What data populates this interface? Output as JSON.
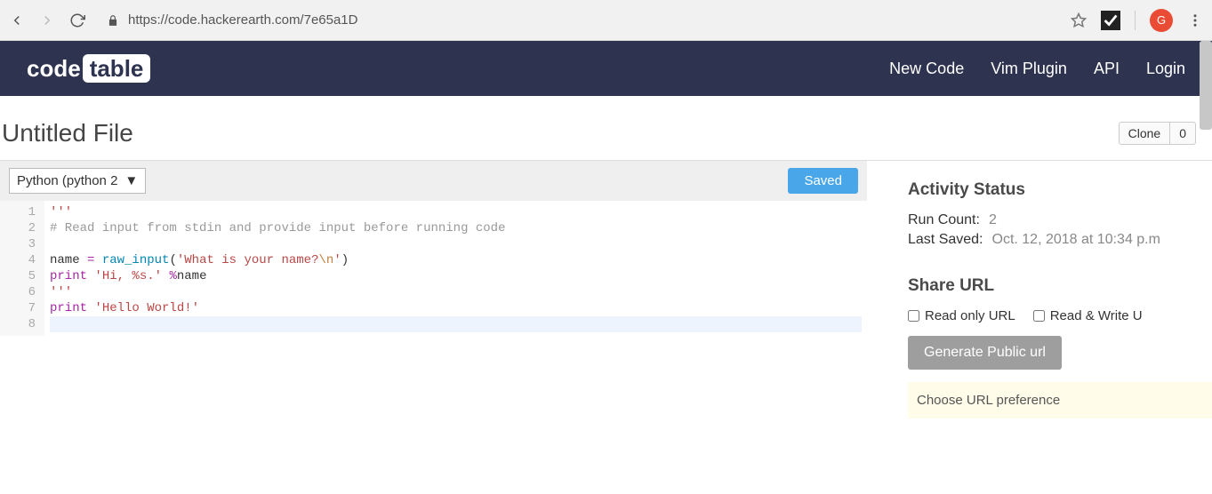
{
  "browser": {
    "url": "https://code.hackerearth.com/7e65a1D",
    "avatar_initial": "G"
  },
  "header": {
    "logo_text_a": "code",
    "logo_text_b": "table",
    "nav": [
      "New Code",
      "Vim Plugin",
      "API",
      "Login"
    ]
  },
  "file": {
    "title": "Untitled File",
    "clone_label": "Clone",
    "clone_count": "0"
  },
  "editor": {
    "language": "Python (python 2",
    "saved_label": "Saved",
    "lines": [
      {
        "n": 1,
        "segments": [
          {
            "t": "'''",
            "c": "str"
          }
        ]
      },
      {
        "n": 2,
        "segments": [
          {
            "t": "# Read input from stdin and provide input before running code",
            "c": "cmt"
          }
        ]
      },
      {
        "n": 3,
        "segments": []
      },
      {
        "n": 4,
        "segments": [
          {
            "t": "name ",
            "c": "op"
          },
          {
            "t": "=",
            "c": "kw"
          },
          {
            "t": " ",
            "c": "op"
          },
          {
            "t": "raw_input",
            "c": "fn"
          },
          {
            "t": "(",
            "c": "op"
          },
          {
            "t": "'What is your name?",
            "c": "str"
          },
          {
            "t": "\\n",
            "c": "esc"
          },
          {
            "t": "'",
            "c": "str"
          },
          {
            "t": ")",
            "c": "op"
          }
        ]
      },
      {
        "n": 5,
        "segments": [
          {
            "t": "print",
            "c": "kw"
          },
          {
            "t": " ",
            "c": "op"
          },
          {
            "t": "'Hi, %s.'",
            "c": "str"
          },
          {
            "t": " ",
            "c": "op"
          },
          {
            "t": "%",
            "c": "kw"
          },
          {
            "t": "name",
            "c": "op"
          }
        ]
      },
      {
        "n": 6,
        "segments": [
          {
            "t": "'''",
            "c": "str"
          }
        ]
      },
      {
        "n": 7,
        "segments": [
          {
            "t": "print",
            "c": "kw"
          },
          {
            "t": " ",
            "c": "op"
          },
          {
            "t": "'Hello World!'",
            "c": "str"
          }
        ]
      },
      {
        "n": 8,
        "segments": [],
        "cursor": true
      }
    ]
  },
  "activity": {
    "heading": "Activity Status",
    "run_count_label": "Run Count:",
    "run_count": "2",
    "last_saved_label": "Last Saved:",
    "last_saved": "Oct. 12, 2018 at 10:34 p.m"
  },
  "share": {
    "heading": "Share URL",
    "readonly_label": "Read only URL",
    "readwrite_label": "Read & Write U",
    "generate_button": "Generate Public url",
    "notice": "Choose URL preference"
  }
}
